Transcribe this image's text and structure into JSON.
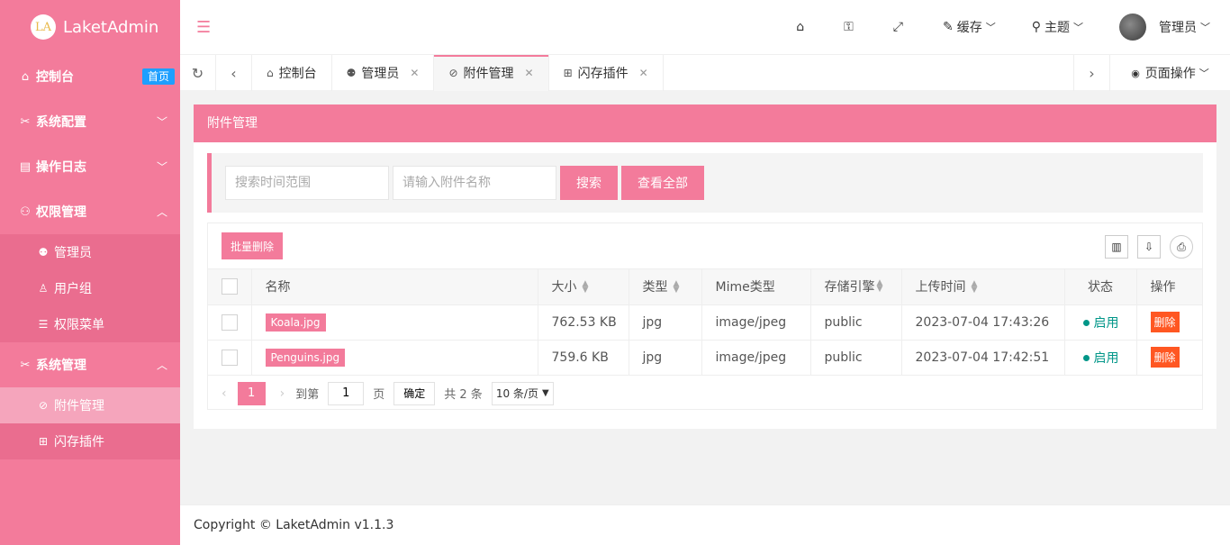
{
  "app": {
    "logo_badge": "LA",
    "name": "LaketAdmin"
  },
  "sidebar": {
    "items": [
      {
        "label": "控制台",
        "badge": "首页"
      },
      {
        "label": "系统配置"
      },
      {
        "label": "操作日志"
      },
      {
        "label": "权限管理",
        "children": [
          {
            "label": "管理员"
          },
          {
            "label": "用户组"
          },
          {
            "label": "权限菜单"
          }
        ]
      },
      {
        "label": "系统管理",
        "children": [
          {
            "label": "附件管理"
          },
          {
            "label": "闪存插件"
          }
        ]
      }
    ]
  },
  "header": {
    "cache_label": "缓存",
    "theme_label": "主题",
    "user_label": "管理员"
  },
  "tabs": {
    "items": [
      {
        "label": "控制台"
      },
      {
        "label": "管理员"
      },
      {
        "label": "附件管理"
      },
      {
        "label": "闪存插件"
      }
    ],
    "page_ops": "页面操作"
  },
  "card": {
    "title": "附件管理",
    "search": {
      "time_placeholder": "搜索时间范围",
      "name_placeholder": "请输入附件名称",
      "search_btn": "搜索",
      "all_btn": "查看全部"
    },
    "batch_delete": "批量删除",
    "columns": [
      "名称",
      "大小",
      "类型",
      "Mime类型",
      "存储引擎",
      "上传时间",
      "状态",
      "操作"
    ],
    "rows": [
      {
        "name": "Koala.jpg",
        "size": "762.53 KB",
        "type": "jpg",
        "mime": "image/jpeg",
        "storage": "public",
        "time": "2023-07-04 17:43:26",
        "status": "启用",
        "action": "删除"
      },
      {
        "name": "Penguins.jpg",
        "size": "759.6 KB",
        "type": "jpg",
        "mime": "image/jpeg",
        "storage": "public",
        "time": "2023-07-04 17:42:51",
        "status": "启用",
        "action": "删除"
      }
    ],
    "pager": {
      "current": "1",
      "goto_label": "到第",
      "goto_value": "1",
      "page_unit": "页",
      "ok_btn": "确定",
      "total": "共 2 条",
      "page_size": "10 条/页"
    }
  },
  "footer": {
    "text": "Copyright © LaketAdmin v1.1.3"
  },
  "colors": {
    "accent": "#f37b9b",
    "status_on": "#009688",
    "danger": "#ff5722",
    "badge_blue": "#1e9fff"
  }
}
